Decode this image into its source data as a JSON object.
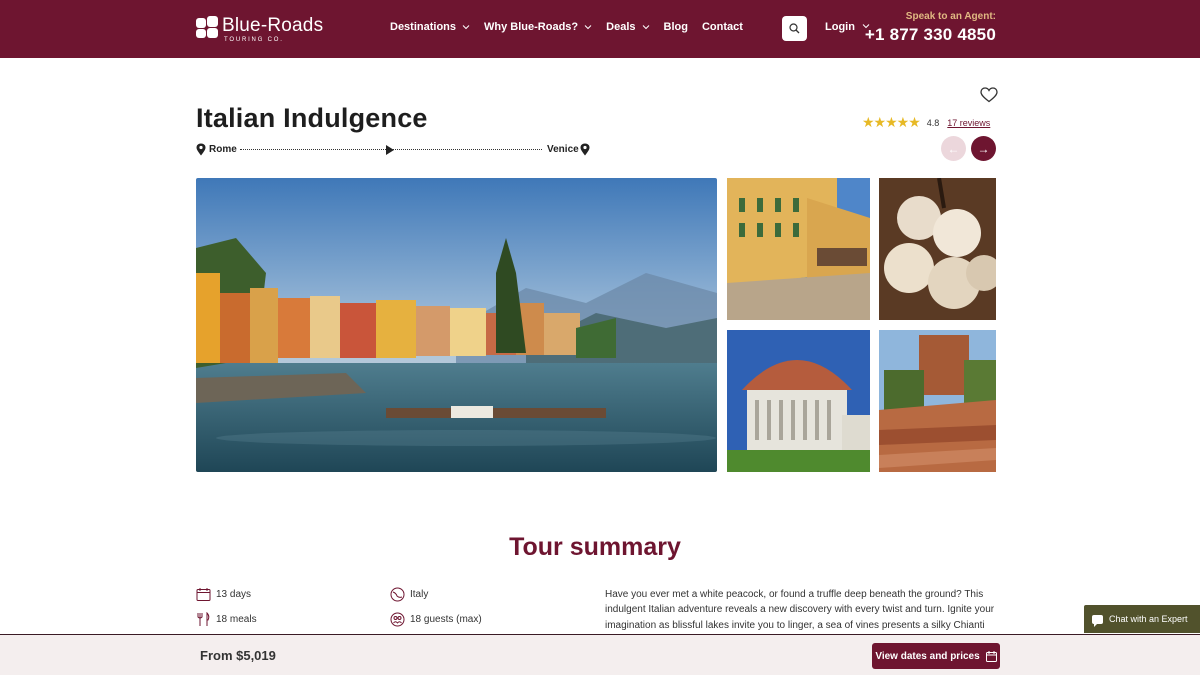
{
  "brand": {
    "name": "Blue-Roads",
    "tagline": "TOURING CO."
  },
  "nav": {
    "items": [
      {
        "label": "Destinations",
        "has_dropdown": true
      },
      {
        "label": "Why Blue-Roads?",
        "has_dropdown": true
      },
      {
        "label": "Deals",
        "has_dropdown": true
      },
      {
        "label": "Blog",
        "has_dropdown": false
      },
      {
        "label": "Contact",
        "has_dropdown": false
      }
    ],
    "search_icon": "search-icon",
    "login_label": "Login"
  },
  "agent": {
    "label": "Speak to an Agent:",
    "phone": "+1 877 330 4850"
  },
  "tour": {
    "title": "Italian Indulgence",
    "rating": "4.8",
    "stars": "★★★★★",
    "reviews_label": "17 reviews",
    "route_from": "Rome",
    "route_to": "Venice"
  },
  "gallery": {
    "images": [
      {
        "name": "lake-village"
      },
      {
        "name": "town-square"
      },
      {
        "name": "garlic"
      },
      {
        "name": "pisa-baptistery"
      },
      {
        "name": "hill-town"
      }
    ]
  },
  "summary": {
    "title": "Tour summary",
    "facts": {
      "duration": "13 days",
      "meals": "18 meals",
      "country": "Italy",
      "guests": "18 guests (max)"
    },
    "description": "Have you ever met a white peacock, or found a truffle deep beneath the ground? This indulgent Italian adventure reveals a new discovery with every twist and turn. Ignite your imagination as blissful lakes invite you to linger, a sea of vines presents a silky Chianti"
  },
  "footer_bar": {
    "price_label": "From $5,019",
    "cta_label": "View dates and prices"
  },
  "chat": {
    "label": "Chat with an Expert"
  },
  "colors": {
    "brand": "#6e1530",
    "gold": "#e0b882",
    "star": "#e7b925",
    "chat": "#51522c"
  }
}
